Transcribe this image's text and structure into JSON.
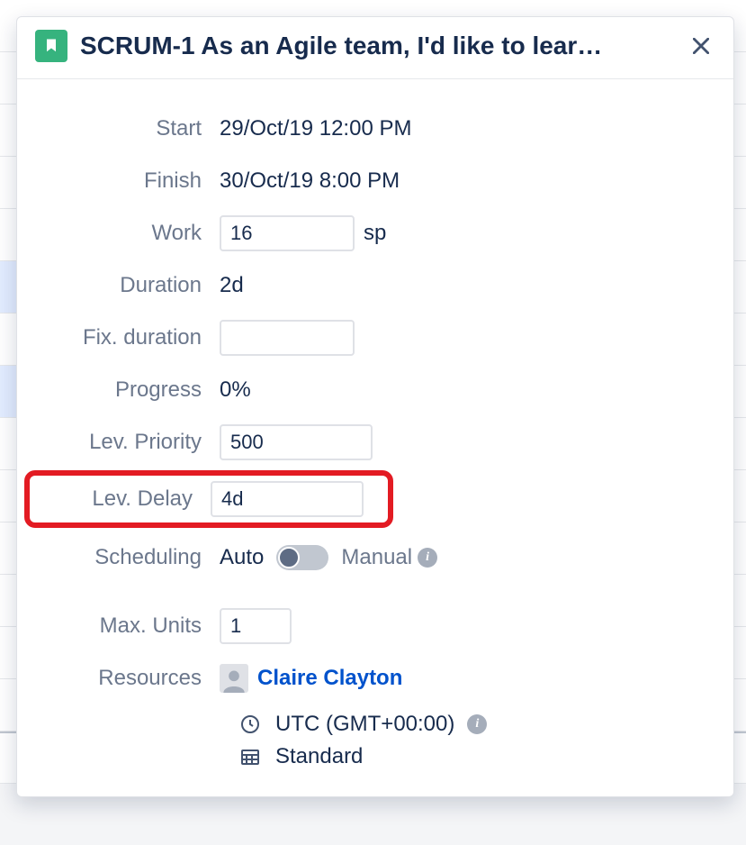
{
  "header": {
    "title": "SCRUM-1 As an Agile team, I'd like to lear…"
  },
  "labels": {
    "start": "Start",
    "finish": "Finish",
    "work": "Work",
    "duration": "Duration",
    "fix_duration": "Fix. duration",
    "progress": "Progress",
    "lev_priority": "Lev. Priority",
    "lev_delay": "Lev. Delay",
    "scheduling": "Scheduling",
    "max_units": "Max. Units",
    "resources": "Resources"
  },
  "values": {
    "start": "29/Oct/19 12:00 PM",
    "finish": "30/Oct/19 8:00 PM",
    "work": "16",
    "work_unit": "sp",
    "duration": "2d",
    "fix_duration": "",
    "progress": "0%",
    "lev_priority": "500",
    "lev_delay": "4d",
    "scheduling_auto": "Auto",
    "scheduling_manual": "Manual",
    "max_units": "1",
    "resource_name": "Claire Clayton",
    "timezone": "UTC (GMT+00:00)",
    "calendar": "Standard"
  }
}
